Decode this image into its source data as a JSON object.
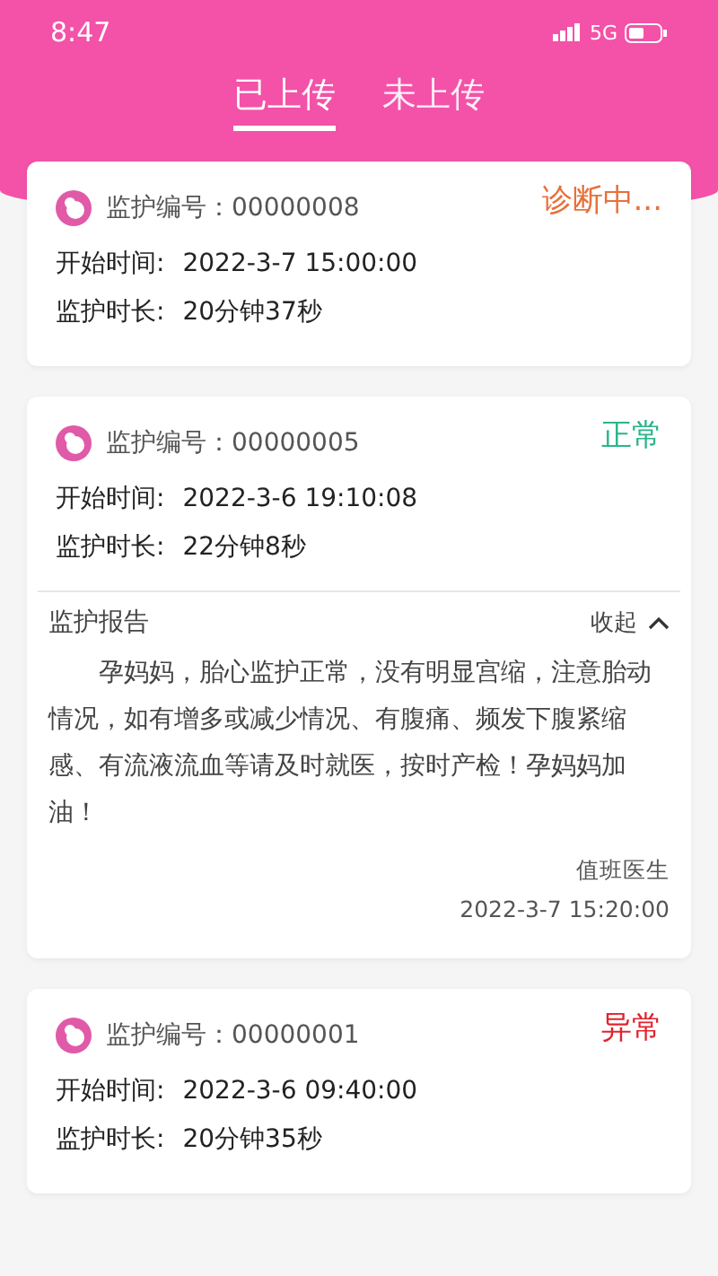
{
  "status_bar": {
    "time": "8:47",
    "network": "5G"
  },
  "tabs": [
    {
      "label": "已上传",
      "selected": true
    },
    {
      "label": "未上传",
      "selected": false
    }
  ],
  "records": [
    {
      "id_label": "监护编号：",
      "id": "00000008",
      "status": "诊断中...",
      "kind": "diagnosing",
      "start_label": "开始时间:",
      "start": "2022-3-7  15:00:00",
      "duration_label": "监护时长:",
      "duration": "20分钟37秒"
    },
    {
      "id_label": "监护编号：",
      "id": "00000005",
      "status": "正常",
      "kind": "normal",
      "start_label": "开始时间:",
      "start": "2022-3-6  19:10:08",
      "duration_label": "监护时长:",
      "duration": "22分钟8秒",
      "report": {
        "title": "监护报告",
        "toggle": "收起",
        "expanded": true,
        "text": "孕妈妈，胎心监护正常，没有明显宫缩，注意胎动情况，如有增多或减少情况、有腹痛、频发下腹紧缩感、有流液流血等请及时就医，按时产检！孕妈妈加油！",
        "signer": "值班医生",
        "time": "2022-3-7  15:20:00"
      }
    },
    {
      "id_label": "监护编号：",
      "id": "00000001",
      "status": "异常",
      "kind": "abnormal",
      "start_label": "开始时间:",
      "start": "2022-3-6  09:40:00",
      "duration_label": "监护时长:",
      "duration": "20分钟35秒"
    }
  ]
}
